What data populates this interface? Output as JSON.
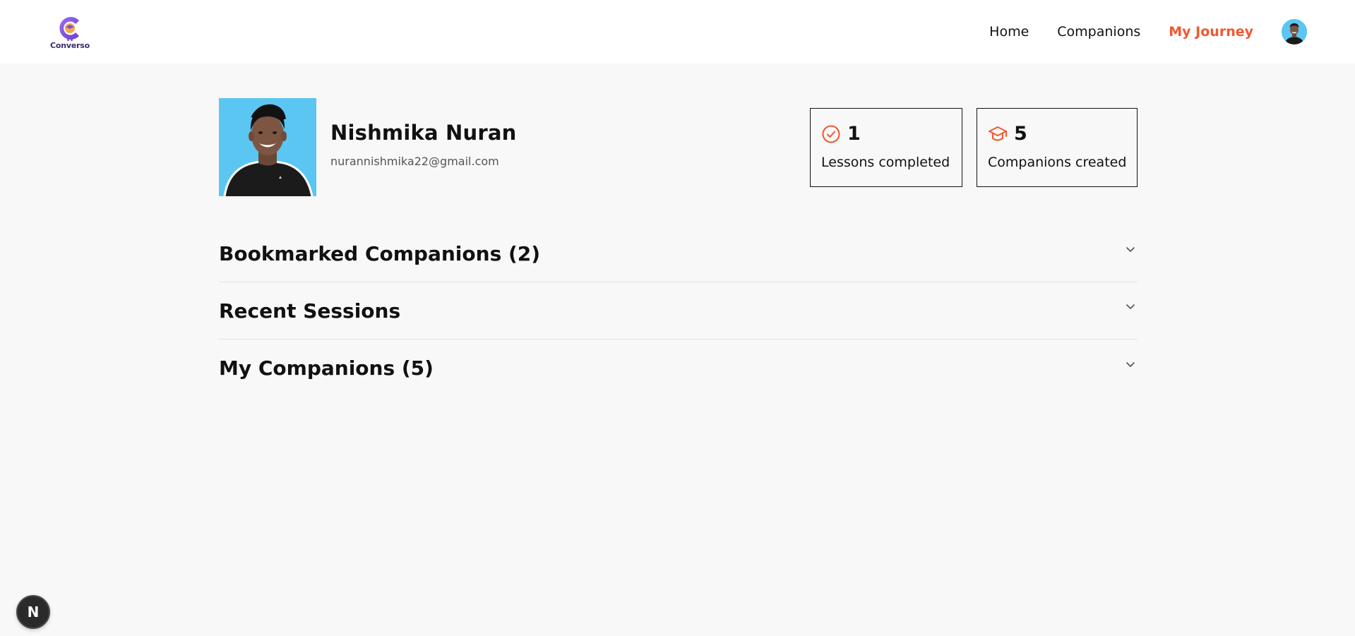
{
  "brand": {
    "name": "Converso"
  },
  "nav": {
    "links": [
      {
        "label": "Home",
        "active": false
      },
      {
        "label": "Companions",
        "active": false
      },
      {
        "label": "My Journey",
        "active": true
      }
    ]
  },
  "profile": {
    "name": "Nishmika Nuran",
    "email": "nurannishmika22@gmail.com"
  },
  "stats": [
    {
      "value": "1",
      "label": "Lessons completed",
      "icon": "check-circle-icon"
    },
    {
      "value": "5",
      "label": "Companions created",
      "icon": "graduation-cap-icon"
    }
  ],
  "sections": [
    {
      "title": "Bookmarked Companions (2)"
    },
    {
      "title": "Recent Sessions"
    },
    {
      "title": "My Companions (5)"
    }
  ],
  "dev_badge": {
    "label": "N"
  },
  "colors": {
    "accent": "#f2572e",
    "brand_purple": "#7a4fe0",
    "page_bg": "#f8f8f8",
    "avatar_bg": "#5bc6f2"
  }
}
